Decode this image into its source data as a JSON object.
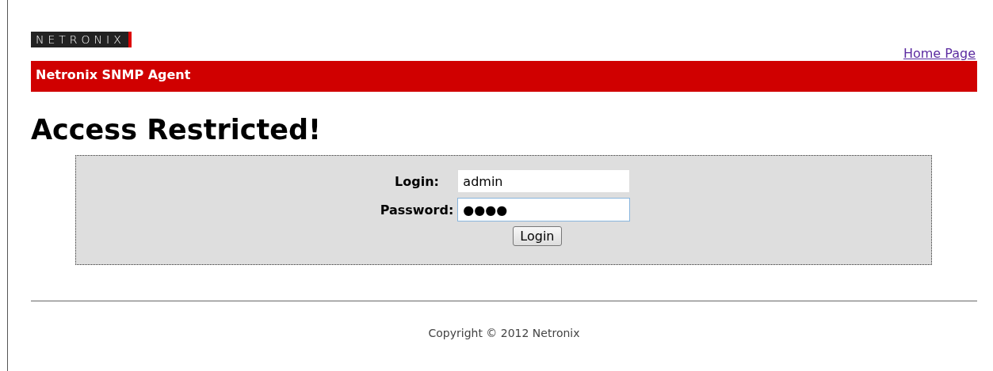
{
  "header": {
    "logo": "NETRONIX",
    "home_link": "Home Page",
    "banner": "Netronix SNMP Agent"
  },
  "heading": "Access Restricted!",
  "form": {
    "fields": [
      {
        "label": "Login:",
        "value": "admin",
        "focused": false
      },
      {
        "label": "Password:",
        "value": "●●●●",
        "focused": true
      }
    ],
    "button": "Login"
  },
  "footer": "Copyright © 2012 Netronix"
}
